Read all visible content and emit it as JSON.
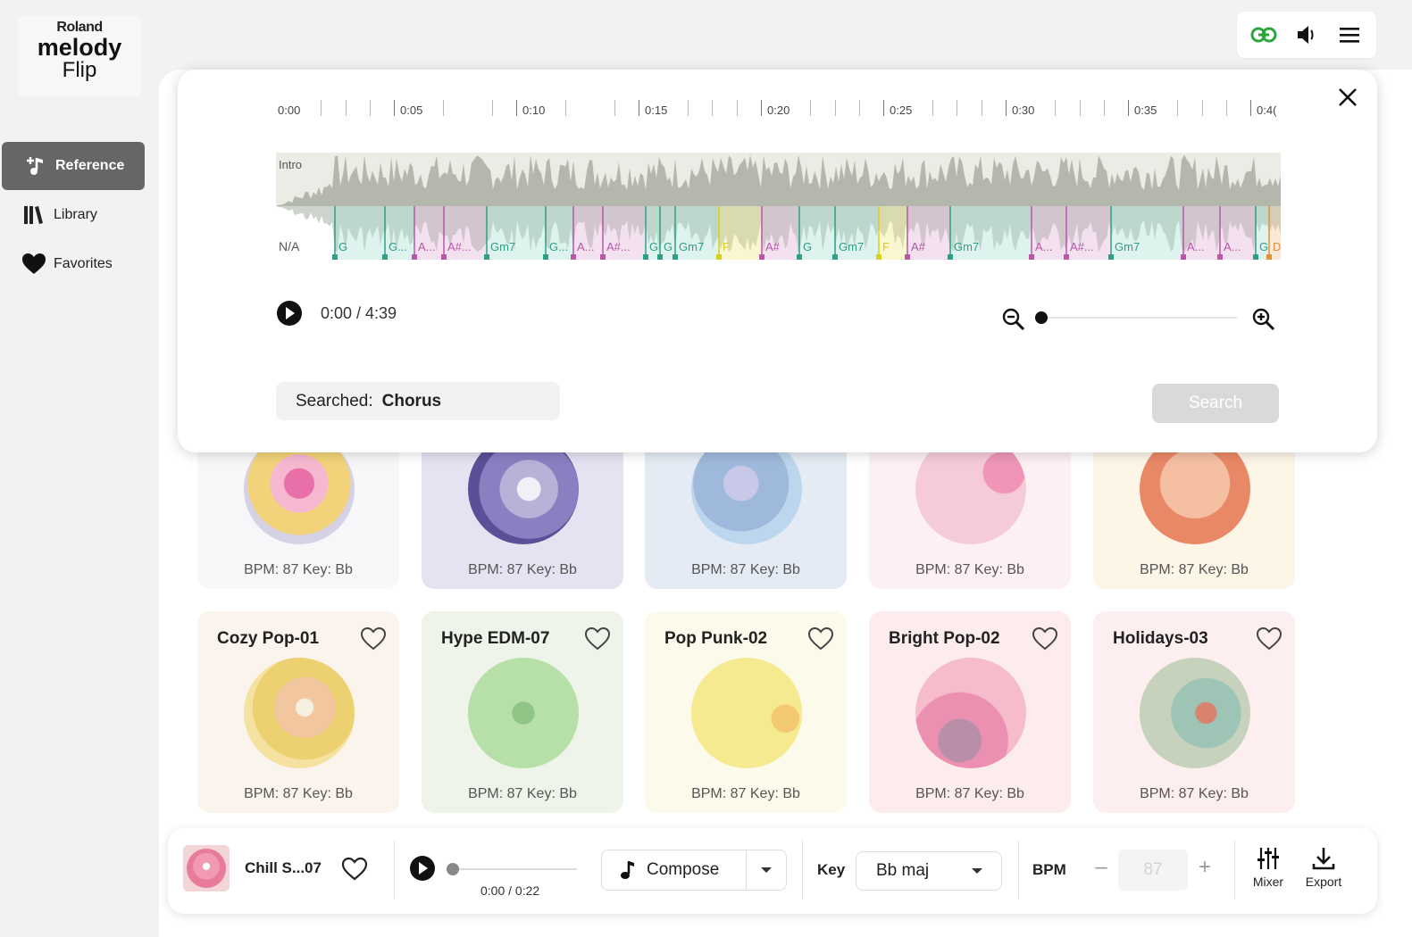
{
  "app": {
    "brand": "Roland",
    "name_line1": "melody",
    "name_line2": "Flip"
  },
  "sidebar": {
    "items": [
      {
        "label": "Reference",
        "icon": "music-note-plus-icon",
        "active": true
      },
      {
        "label": "Library",
        "icon": "library-books-icon",
        "active": false
      },
      {
        "label": "Favorites",
        "icon": "heart-filled-icon",
        "active": false
      }
    ]
  },
  "toolbar": {
    "icons": [
      "link-icon",
      "speaker-icon",
      "hamburger-menu-icon"
    ],
    "link_color": "#2aa63a"
  },
  "reference_panel": {
    "timeline_labels": [
      "0:00",
      "0:05",
      "0:10",
      "0:15",
      "0:20",
      "0:25",
      "0:30",
      "0:35",
      "0:4("
    ],
    "section_label": "Intro",
    "key_label": "N/A",
    "chords": [
      "G",
      "G...",
      "A...",
      "A#...",
      "Gm7",
      "G...",
      "A...",
      "A#...",
      "G",
      "G",
      "Gm7",
      "F",
      "A#",
      "G",
      "Gm7",
      "F",
      "A#",
      "Gm7",
      "A...",
      "A#...",
      "Gm7",
      "A...",
      "A...",
      "G",
      "D"
    ],
    "time_display": "0:00 / 4:39",
    "zoom_level": 0.0,
    "searched_label": "Searched:",
    "searched_value": "Chorus",
    "search_button": "Search"
  },
  "cards_top_row": [
    {
      "bpm_key": "BPM: 87  Key: Bb",
      "bg": "#f7f7f9"
    },
    {
      "bpm_key": "BPM: 87  Key: Bb",
      "bg": "#e4e3f2"
    },
    {
      "bpm_key": "BPM: 87  Key: Bb",
      "bg": "#e4ebf4"
    },
    {
      "bpm_key": "BPM: 87  Key: Bb",
      "bg": "#fcf0f2"
    },
    {
      "bpm_key": "BPM: 87  Key: Bb",
      "bg": "#fdf5e6"
    }
  ],
  "cards_bottom_row": [
    {
      "title": "Cozy Pop-01",
      "bpm_key": "BPM: 87  Key: Bb",
      "bg": "#fbf4ec"
    },
    {
      "title": "Hype EDM-07",
      "bpm_key": "BPM: 87  Key: Bb",
      "bg": "#eef4ea"
    },
    {
      "title": "Pop Punk-02",
      "bpm_key": "BPM: 87  Key: Bb",
      "bg": "#fcfaea"
    },
    {
      "title": "Bright Pop-02",
      "bpm_key": "BPM: 87  Key: Bb",
      "bg": "#fcecee"
    },
    {
      "title": "Holidays-03",
      "bpm_key": "BPM: 87  Key: Bb",
      "bg": "#fdeef0"
    }
  ],
  "player": {
    "track_name": "Chill S...07",
    "time": "0:00 / 0:22",
    "compose_label": "Compose",
    "key_label": "Key",
    "key_value": "Bb maj",
    "bpm_label": "BPM",
    "bpm_minus": "–",
    "bpm_value": "87",
    "bpm_plus": "+",
    "mixer_label": "Mixer",
    "export_label": "Export"
  }
}
